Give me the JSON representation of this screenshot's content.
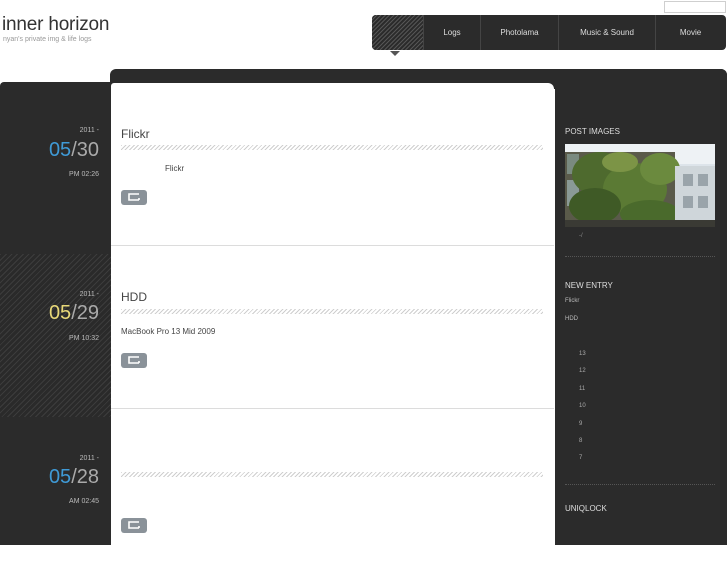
{
  "header": {
    "site_title": "inner horizon",
    "site_subtitle": "nyan's private img & life logs"
  },
  "nav": {
    "items": [
      {
        "label": "Logs"
      },
      {
        "label": "Photolama"
      },
      {
        "label": "Music & Sound"
      },
      {
        "label": "Movie"
      }
    ]
  },
  "entries": [
    {
      "year": "2011 -",
      "month": "05",
      "day": "30",
      "time": "PM 02:26",
      "title": "Flickr",
      "body": "Flickr"
    },
    {
      "year": "2011 -",
      "month": "05",
      "day": "29",
      "time": "PM 10:32",
      "title": "HDD",
      "body": "MacBook Pro 13   Mid 2009"
    },
    {
      "year": "2011 -",
      "month": "05",
      "day": "28",
      "time": "AM 02:45",
      "title": "",
      "body": ""
    }
  ],
  "sidebar": {
    "post_images_heading": "POST IMAGES",
    "post_images_mark": "-/",
    "new_entry_heading": "NEW ENTRY",
    "new_entries": [
      "Flickr",
      "HDD"
    ],
    "archive_numbers": [
      "13",
      "12",
      "11",
      "10",
      "9",
      "8",
      "7"
    ],
    "uniqlock_heading": "UNIQLOCK"
  },
  "colors": {
    "accent_blue": "#3f9ad6",
    "accent_yellow": "#e8d878",
    "dark_bg": "#2b2b2b"
  }
}
